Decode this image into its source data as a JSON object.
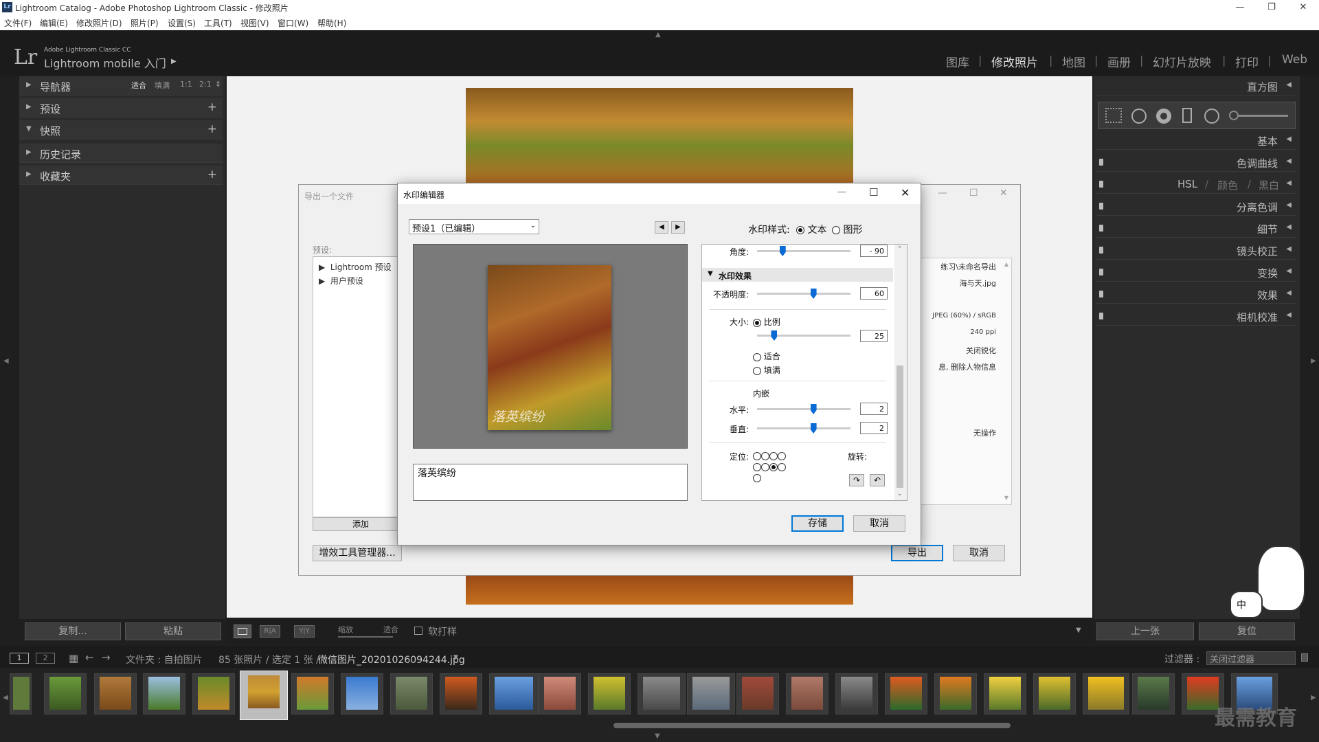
{
  "window": {
    "title": "Lightroom Catalog - Adobe Photoshop Lightroom Classic - 修改照片",
    "app_icon": "Lr",
    "min_icon": "minimize-icon",
    "max_icon": "restore-icon",
    "close_icon": "close-icon"
  },
  "menu": [
    "文件(F)",
    "编辑(E)",
    "修改照片(D)",
    "照片(P)",
    "设置(S)",
    "工具(T)",
    "视图(V)",
    "窗口(W)",
    "帮助(H)"
  ],
  "identity": {
    "logo": "Lr",
    "subtitle": "Adobe Lightroom Classic CC",
    "title": "Lightroom mobile 入门"
  },
  "modules": [
    "图库",
    "修改照片",
    "地图",
    "画册",
    "幻灯片放映",
    "打印",
    "Web"
  ],
  "left_panel": {
    "navigator": "导航器",
    "nav_options": [
      "适合",
      "填满",
      "1:1",
      "2:1"
    ],
    "presets": "预设",
    "snapshots": "快照",
    "history": "历史记录",
    "collections": "收藏夹",
    "copy_button": "复制...",
    "paste_button": "粘贴"
  },
  "right_panel": {
    "histogram": "直方图",
    "basic": "基本",
    "tone_curve": "色调曲线",
    "hsl": "HSL",
    "color": "颜色",
    "bw": "黑白",
    "split_toning": "分离色调",
    "detail": "细节",
    "lens": "镜头校正",
    "transform": "变换",
    "effects": "效果",
    "calibration": "相机校准",
    "prev_button": "上一张",
    "reset_button": "复位"
  },
  "toolbar": {
    "zoom_label": "缩放",
    "zoom_value": "适合",
    "softproof": "软打样",
    "view_ra": "R|A",
    "view_yy": "Y|Y"
  },
  "filmstrip_bar": {
    "screen1": "1",
    "screen2": "2",
    "source": "文件夹 : 自拍图片",
    "count": "85 张照片 / 选定 1 张 /",
    "filename": "微信图片_20201026094244.jpg",
    "filter_label": "过滤器 :",
    "filter_value": "关闭过滤器"
  },
  "export_dialog": {
    "title": "导出一个文件",
    "preset_label": "预设:",
    "tree": [
      "Lightroom 预设",
      "用户预设"
    ],
    "add_button": "添加",
    "plugin_button": "增效工具管理器...",
    "export_button": "导出",
    "cancel_button": "取消",
    "summary": [
      "练习\\未命名导出",
      "海与天.jpg",
      "",
      "JPEG (60%) / sRGB",
      "240 ppi",
      "关闭锐化",
      "息, 删除人物信息",
      "",
      "",
      "无操作"
    ]
  },
  "watermark_dialog": {
    "title": "水印编辑器",
    "preset_select": "预设1（已编辑）",
    "style_label": "水印样式:",
    "style_text": "文本",
    "style_graphic": "图形",
    "watermark_text": "落英缤纷",
    "angle_label": "角度:",
    "angle_value": "- 90",
    "effects_header": "水印效果",
    "opacity_label": "不透明度:",
    "opacity_value": "60",
    "size_label": "大小:",
    "size_proportional": "比例",
    "size_value": "25",
    "size_fit": "适合",
    "size_fill": "填满",
    "inset_label": "内嵌",
    "horizontal_label": "水平:",
    "horizontal_value": "2",
    "vertical_label": "垂直:",
    "vertical_value": "2",
    "anchor_label": "定位:",
    "rotate_label": "旋转:",
    "save_button": "存储",
    "cancel_button": "取消",
    "sliders": {
      "angle": 0.27,
      "opacity": 0.6,
      "size": 0.18,
      "horizontal": 0.6,
      "vertical": 0.6
    }
  },
  "watermark_brand": "最需教育",
  "ime": "中"
}
